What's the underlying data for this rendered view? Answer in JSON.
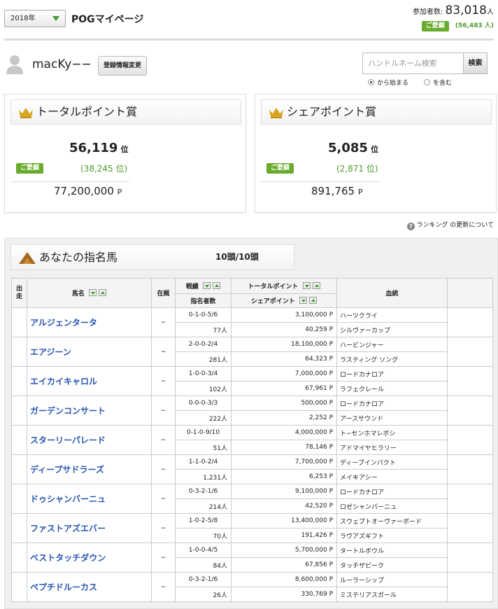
{
  "header": {
    "year_select": "2018年",
    "page_title": "POGマイページ",
    "participants_label": "参加者数:",
    "participants_count": "83,018",
    "participants_unit": "人",
    "fav_badge": "ご愛顧",
    "fav_count": "(56,483 人)"
  },
  "user": {
    "name": "macKy−−",
    "edit_button": "登録情報変更"
  },
  "search": {
    "placeholder": "ハンドルネーム検索",
    "button": "検索",
    "option_prefix": "から始まる",
    "option_contains": "を含む"
  },
  "total_award": {
    "title": "トータルポイント賞",
    "rank": "56,119",
    "rank_unit": "位",
    "fav_badge": "ご愛顧",
    "fav_rank": "(38,245 位)",
    "points": "77,200,000",
    "points_unit": "P"
  },
  "share_award": {
    "title": "シェアポイント賞",
    "rank": "5,085",
    "rank_unit": "位",
    "fav_badge": "ご愛顧",
    "fav_rank": "(2,871 位)",
    "points": "891,765",
    "points_unit": "P"
  },
  "help_link": "ランキング",
  "help_text": "の更新について",
  "horses_section": {
    "title": "あなたの指名馬",
    "count": "10頭/10頭",
    "columns": {
      "start": "出走",
      "name": "馬名",
      "stable": "在厩",
      "record": "戦績",
      "nominators": "指名者数",
      "total_points": "トータルポイント",
      "share_points": "シェアポイント",
      "pedigree": "血統"
    },
    "rows": [
      {
        "name": "アルジェンタータ",
        "stable": "−",
        "record": "0-1-0-5/6",
        "nominators": "77人",
        "total": "3,100,000 P",
        "share": "40,259 P",
        "sire": "ハーツクライ",
        "dam": "シルヴァーカップ"
      },
      {
        "name": "エアジーン",
        "stable": "−",
        "record": "2-0-0-2/4",
        "nominators": "281人",
        "total": "18,100,000 P",
        "share": "64,323 P",
        "sire": "ハービンジャー",
        "dam": "ラスティング ソング"
      },
      {
        "name": "エイカイキャロル",
        "stable": "−",
        "record": "1-0-0-3/4",
        "nominators": "102人",
        "total": "7,000,000 P",
        "share": "67,961 P",
        "sire": "ロードカナロア",
        "dam": "ラフェクレール"
      },
      {
        "name": "ガーデンコンサート",
        "stable": "−",
        "record": "0-0-0-3/3",
        "nominators": "222人",
        "total": "500,000 P",
        "share": "2,252 P",
        "sire": "ロードカナロア",
        "dam": "アースサウンド"
      },
      {
        "name": "スターリーパレード",
        "stable": "−",
        "record": "0-1-0-9/10",
        "nominators": "51人",
        "total": "4,000,000 P",
        "share": "78,146 P",
        "sire": "ト−センホマレボシ",
        "dam": "アドマイヤヒラリー"
      },
      {
        "name": "ディープサドラーズ",
        "stable": "−",
        "record": "1-1-0-2/4",
        "nominators": "1,231人",
        "total": "7,700,000 P",
        "share": "6,253 P",
        "sire": "ディープインパクト",
        "dam": "メイキアシー"
      },
      {
        "name": "ドゥシャンバーニュ",
        "stable": "−",
        "record": "0-3-2-1/6",
        "nominators": "214人",
        "total": "9,100,000 P",
        "share": "42,520 P",
        "sire": "ロードカナロア",
        "dam": "ロゼシャンパーニュ"
      },
      {
        "name": "ファストアズエバー",
        "stable": "−",
        "record": "1-0-2-5/8",
        "nominators": "70人",
        "total": "13,400,000 P",
        "share": "191,426 P",
        "sire": "スウェプトオーヴァーボード",
        "dam": "ラヴアズギフト"
      },
      {
        "name": "ベストタッチダウン",
        "stable": "−",
        "record": "1-0-0-4/5",
        "nominators": "84人",
        "total": "5,700,000 P",
        "share": "67,856 P",
        "sire": "タートルボウル",
        "dam": "タッチザピーク"
      },
      {
        "name": "ペプチドルーカス",
        "stable": "−",
        "record": "0-3-2-1/6",
        "nominators": "26人",
        "total": "8,600,000 P",
        "share": "330,769 P",
        "sire": "ルーラーシップ",
        "dam": "ミステリアスガール"
      }
    ]
  }
}
